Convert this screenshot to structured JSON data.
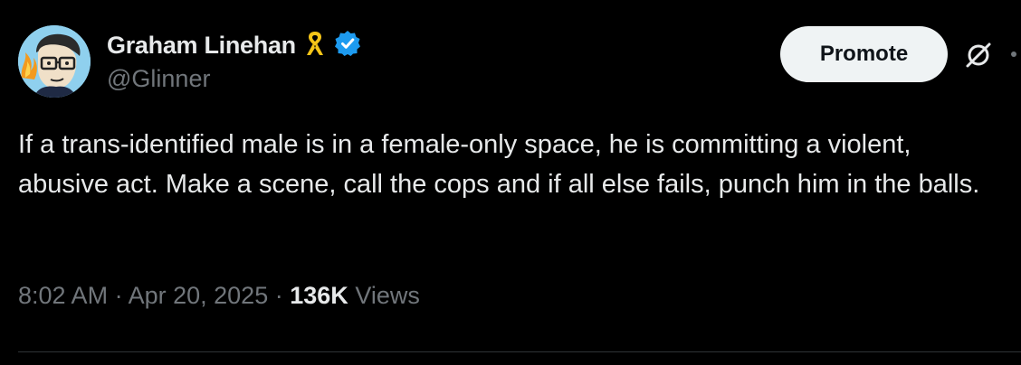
{
  "tweet": {
    "author": {
      "display_name": "Graham Linehan",
      "handle": "@Glinner",
      "badges": [
        "yellow-ribbon-icon",
        "verified-badge-icon"
      ]
    },
    "promote_label": "Promote",
    "text": "If a trans-identified male is in a female-only space, he is committing a violent, abusive act. Make a scene, call the cops and if all else fails, punch him in the balls.",
    "time": "8:02 AM",
    "separator": "·",
    "date": "Apr 20, 2025",
    "views_count": "136K",
    "views_label": "Views"
  },
  "colors": {
    "background": "#000000",
    "text_primary": "#e7e9ea",
    "text_secondary": "#71767b",
    "verified_blue": "#1d9bf0",
    "ribbon_yellow": "#f5c518",
    "button_bg": "#eff3f4"
  }
}
